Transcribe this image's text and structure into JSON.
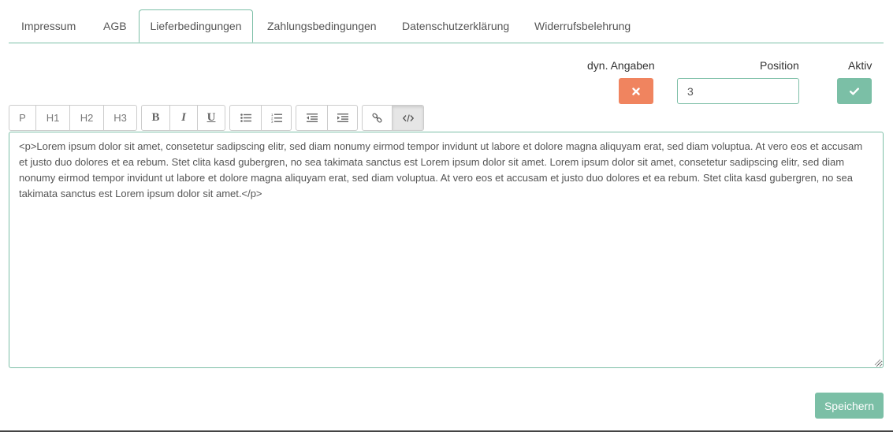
{
  "tabs": [
    {
      "label": "Impressum",
      "active": false
    },
    {
      "label": "AGB",
      "active": false
    },
    {
      "label": "Lieferbedingungen",
      "active": true
    },
    {
      "label": "Zahlungsbedingungen",
      "active": false
    },
    {
      "label": "Datenschutzerklärung",
      "active": false
    },
    {
      "label": "Widerrufsbelehrung",
      "active": false
    }
  ],
  "fields": {
    "dyn_label": "dyn. Angaben",
    "position_label": "Position",
    "position_value": "3",
    "aktiv_label": "Aktiv"
  },
  "toolbar": {
    "p": "P",
    "h1": "H1",
    "h2": "H2",
    "h3": "H3",
    "bold": "B",
    "italic": "I",
    "underline": "U",
    "icons": [
      "bullet-list-icon",
      "numbered-list-icon",
      "outdent-icon",
      "indent-icon",
      "link-icon",
      "code-view-icon"
    ],
    "active_button": "code-view"
  },
  "editor": {
    "content": "<p>Lorem ipsum dolor sit amet, consetetur sadipscing elitr, sed diam nonumy eirmod tempor invidunt ut labore et dolore magna aliquyam erat, sed diam voluptua. At vero eos et accusam et justo duo dolores et ea rebum. Stet clita kasd gubergren, no sea takimata sanctus est Lorem ipsum dolor sit amet. Lorem ipsum dolor sit amet, consetetur sadipscing elitr, sed diam nonumy eirmod tempor invidunt ut labore et dolore magna aliquyam erat, sed diam voluptua. At vero eos et accusam et justo duo dolores et ea rebum. Stet clita kasd gubergren, no sea takimata sanctus est Lorem ipsum dolor sit amet.</p>"
  },
  "actions": {
    "save_label": "Speichern"
  },
  "colors": {
    "accent": "#7bbfa6",
    "danger": "#f0845f",
    "border": "#7dbfa7"
  }
}
